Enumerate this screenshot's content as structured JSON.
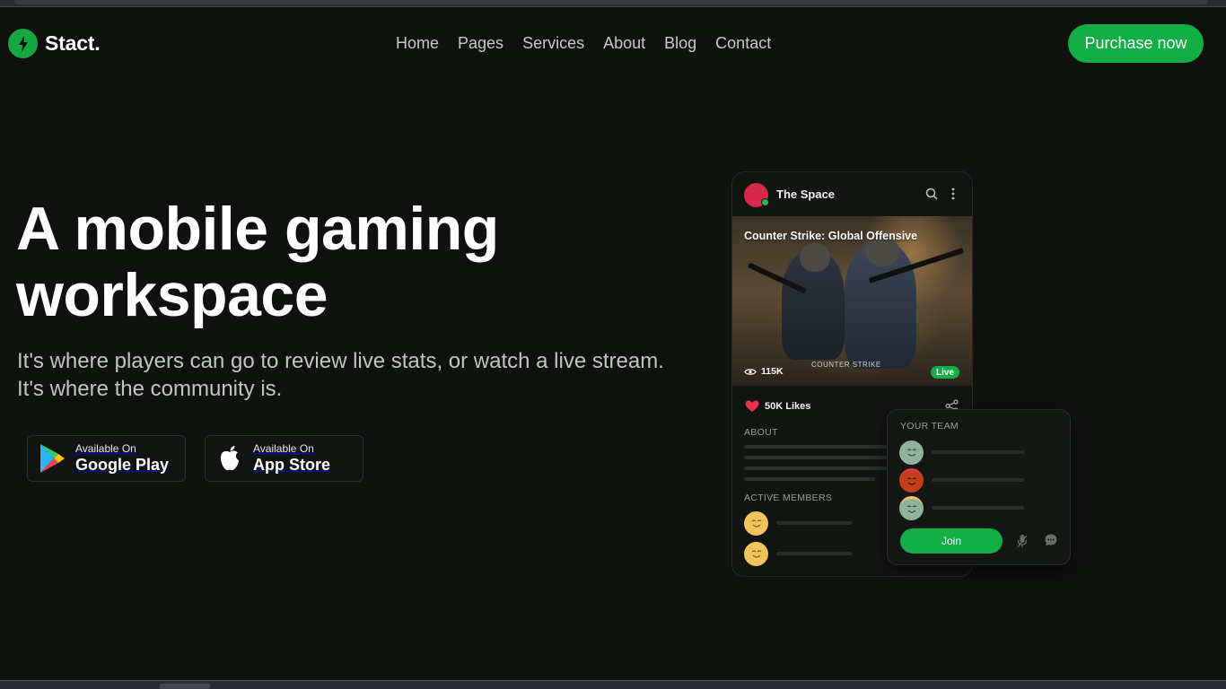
{
  "brand": {
    "name": "Stact.",
    "color": "#14a742",
    "icon": "bolt-icon"
  },
  "nav": {
    "items": [
      {
        "label": "Home"
      },
      {
        "label": "Pages"
      },
      {
        "label": "Services"
      },
      {
        "label": "About"
      },
      {
        "label": "Blog"
      },
      {
        "label": "Contact"
      }
    ],
    "cta": "Purchase now"
  },
  "hero": {
    "title_line1": "A mobile gaming",
    "title_line2": "workspace",
    "subtitle_line1": "It's where players can go to review live stats, or watch a live stream.",
    "subtitle_line2": "It's where the community is."
  },
  "stores": {
    "google": {
      "small": "Available On",
      "big": "Google Play",
      "icon": "google-play-icon"
    },
    "apple": {
      "small": "Available On",
      "big": "App Store",
      "icon": "apple-icon"
    }
  },
  "phone": {
    "space_name": "The Space",
    "game_title": "Counter Strike: Global Offensive",
    "game_logo_text": "COUNTER STRIKE",
    "views": "115K",
    "live_label": "Live",
    "likes": "50K Likes",
    "about_label": "ABOUT",
    "members_label": "ACTIVE MEMBERS"
  },
  "team": {
    "label": "YOUR TEAM",
    "join_label": "Join"
  },
  "colors": {
    "accent": "#12ad45",
    "background": "#0f110f",
    "muted_text": "#c3c5c3"
  }
}
